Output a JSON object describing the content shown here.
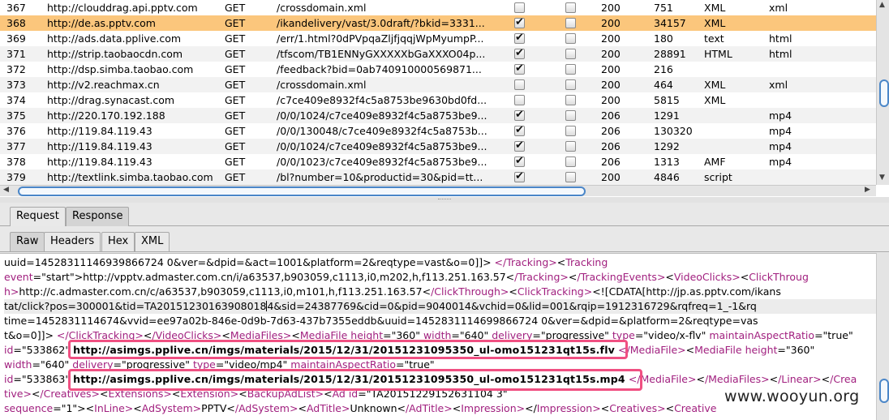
{
  "history": {
    "rows": [
      {
        "num": "367",
        "host": "http://clouddrag.api.pptv.com",
        "method": "GET",
        "url": "/crossdomain.xml",
        "chk1": false,
        "chk2": false,
        "status": "200",
        "length": "751",
        "mime": "XML",
        "ext": "xml",
        "state": "plain"
      },
      {
        "num": "368",
        "host": "http://de.as.pptv.com",
        "method": "GET",
        "url": "/ikandelivery/vast/3.0draft/?bkid=3331...",
        "chk1": true,
        "chk2": false,
        "status": "200",
        "length": "34157",
        "mime": "XML",
        "ext": "",
        "state": "selected"
      },
      {
        "num": "369",
        "host": "http://ads.data.pplive.com",
        "method": "GET",
        "url": "/err/1.html?0dPVpqaZljfjqqjWpMyumpP...",
        "chk1": true,
        "chk2": false,
        "status": "200",
        "length": "180",
        "mime": "text",
        "ext": "html",
        "state": "plain"
      },
      {
        "num": "371",
        "host": "http://strip.taobaocdn.com",
        "method": "GET",
        "url": "/tfscom/TB1ENNyGXXXXXbGaXXXO04p...",
        "chk1": true,
        "chk2": false,
        "status": "200",
        "length": "28891",
        "mime": "HTML",
        "ext": "html",
        "state": "alt"
      },
      {
        "num": "372",
        "host": "http://dsp.simba.taobao.com",
        "method": "GET",
        "url": "/feedback?bid=0ab740910000569871...",
        "chk1": true,
        "chk2": false,
        "status": "200",
        "length": "216",
        "mime": "",
        "ext": "",
        "state": "plain"
      },
      {
        "num": "373",
        "host": "http://v2.reachmax.cn",
        "method": "GET",
        "url": "/crossdomain.xml",
        "chk1": false,
        "chk2": false,
        "status": "200",
        "length": "464",
        "mime": "XML",
        "ext": "xml",
        "state": "alt"
      },
      {
        "num": "374",
        "host": "http://drag.synacast.com",
        "method": "GET",
        "url": "/c7ce409e8932f4c5a8753be9630bd0fd...",
        "chk1": false,
        "chk2": false,
        "status": "200",
        "length": "5815",
        "mime": "XML",
        "ext": "",
        "state": "plain"
      },
      {
        "num": "375",
        "host": "http://220.170.192.188",
        "method": "GET",
        "url": "/0/0/1024/c7ce409e8932f4c5a8753be9...",
        "chk1": true,
        "chk2": false,
        "status": "206",
        "length": "1291",
        "mime": "",
        "ext": "mp4",
        "state": "alt"
      },
      {
        "num": "376",
        "host": "http://119.84.119.43",
        "method": "GET",
        "url": "/0/0/130048/c7ce409e8932f4c5a8753b...",
        "chk1": true,
        "chk2": false,
        "status": "206",
        "length": "130320",
        "mime": "",
        "ext": "mp4",
        "state": "plain"
      },
      {
        "num": "377",
        "host": "http://119.84.119.43",
        "method": "GET",
        "url": "/0/0/1024/c7ce409e8932f4c5a8753be9...",
        "chk1": true,
        "chk2": false,
        "status": "206",
        "length": "1292",
        "mime": "",
        "ext": "mp4",
        "state": "alt"
      },
      {
        "num": "378",
        "host": "http://119.84.119.43",
        "method": "GET",
        "url": "/0/0/1023/c7ce409e8932f4c5a8753be9...",
        "chk1": true,
        "chk2": false,
        "status": "206",
        "length": "1313",
        "mime": "AMF",
        "ext": "mp4",
        "state": "plain"
      },
      {
        "num": "379",
        "host": "http://textlink.simba.taobao.com",
        "method": "GET",
        "url": "/bl?number=10&productid=30&pid=tt...",
        "chk1": true,
        "chk2": false,
        "status": "200",
        "length": "4846",
        "mime": "script",
        "ext": "",
        "state": "alt"
      }
    ]
  },
  "tabs_top": {
    "request": "Request",
    "response": "Response",
    "active": "Response"
  },
  "tabs_sub": {
    "raw": "Raw",
    "headers": "Headers",
    "hex": "Hex",
    "xml": "XML",
    "active": "Raw"
  },
  "response": {
    "lines": [
      [
        [
          "t",
          "uuid=14528311146939866724 0&ver=&dpid=&act=1001&platform=2&reqtype=vast&o=0]]"
        ],
        [
          "t",
          "> "
        ],
        [
          "m",
          "</Tracking>"
        ],
        [
          "t",
          "<"
        ],
        [
          "m",
          "Tracking"
        ]
      ],
      [
        [
          "m",
          "event"
        ],
        [
          "t",
          "=\"start\">http://vpptv.admaster.com.cn/i/a63537,b903059,c1113,i0,m202,h,f113.251.163.57<"
        ],
        [
          "m",
          "/Tracking>"
        ],
        [
          "t",
          "<"
        ],
        [
          "m",
          "/TrackingEvents>"
        ],
        [
          "t",
          "<"
        ],
        [
          "m",
          "VideoClicks>"
        ],
        [
          "t",
          "<"
        ],
        [
          "m",
          "ClickThroug"
        ]
      ],
      [
        [
          "m",
          "h>"
        ],
        [
          "t",
          "http://c.admaster.com.cn/c/a63537,b903059,c1113,i0,m101,h,f113.251.163.57<"
        ],
        [
          "m",
          "/ClickThrough>"
        ],
        [
          "t",
          "<"
        ],
        [
          "m",
          "ClickTracking>"
        ],
        [
          "t",
          "<![CDATA[http://jp.as.pptv.com/ikans"
        ]
      ],
      [
        [
          "t",
          "tat/click?pos=300001&tid=TA20151230163908018"
        ],
        [
          "cursor",
          ""
        ],
        [
          "t",
          "4&sid=24387769&cid=0&pid=9040014&vchid=0&lid=001&rqip=1912316729&rqfreq=1_-1&rq"
        ]
      ],
      [
        [
          "t",
          "time=1452831114674&vvid=ee97a02b-846e-0d9b-7d63-437b7355eddb&uuid=1452831114699866724 0&ver=&dpid=&platform=2&reqtype=vas"
        ]
      ],
      [
        [
          "t",
          "t&o=0]]>"
        ],
        [
          "m",
          " </ClickTracking>"
        ],
        [
          "t",
          "<"
        ],
        [
          "m",
          "/VideoClicks>"
        ],
        [
          "t",
          "<"
        ],
        [
          "m",
          "MediaFiles>"
        ],
        [
          "t",
          "<"
        ],
        [
          "m",
          "MediaFile height"
        ],
        [
          "t",
          "=\"360\" "
        ],
        [
          "m",
          "width"
        ],
        [
          "t",
          "=\"640\" "
        ],
        [
          "m",
          "delivery"
        ],
        [
          "t",
          "=\"progressive\" "
        ],
        [
          "m",
          "type"
        ],
        [
          "t",
          "=\"video/x-flv\" "
        ],
        [
          "m",
          "maintainAspectRatio"
        ],
        [
          "t",
          "=\"true\""
        ]
      ],
      [
        [
          "m",
          "id"
        ],
        [
          "t",
          "=\"533862\" "
        ],
        [
          "b",
          "http://asimgs.pplive.cn/imgs/materials/2015/12/31/20151231095350_ul-omo151231qt15s.flv"
        ],
        [
          "t",
          " "
        ],
        [
          "m",
          "</MediaFile>"
        ],
        [
          "t",
          "<"
        ],
        [
          "m",
          "MediaFile height"
        ],
        [
          "t",
          "=\"360\""
        ]
      ],
      [
        [
          "m",
          "width"
        ],
        [
          "t",
          "=\"640\" "
        ],
        [
          "m",
          "delivery"
        ],
        [
          "t",
          "=\"progressive\" "
        ],
        [
          "m",
          "type"
        ],
        [
          "t",
          "=\"video/mp4\" "
        ],
        [
          "m",
          "maintainAspectRatio"
        ],
        [
          "t",
          "=\"true\""
        ]
      ],
      [
        [
          "m",
          "id"
        ],
        [
          "t",
          "=\"533863\" "
        ],
        [
          "b",
          "http://asimgs.pplive.cn/imgs/materials/2015/12/31/20151231095350_ul-omo151231qt15s.mp4"
        ],
        [
          "t",
          " "
        ],
        [
          "m",
          "</MediaFile>"
        ],
        [
          "t",
          "<"
        ],
        [
          "m",
          "/MediaFiles>"
        ],
        [
          "t",
          "<"
        ],
        [
          "m",
          "/Linear>"
        ],
        [
          "t",
          "<"
        ],
        [
          "m",
          "/Crea"
        ]
      ],
      [
        [
          "m",
          "tive>"
        ],
        [
          "t",
          "<"
        ],
        [
          "m",
          "/Creatives>"
        ],
        [
          "t",
          "<"
        ],
        [
          "m",
          "Extensions>"
        ],
        [
          "t",
          "<"
        ],
        [
          "m",
          "Extension>"
        ],
        [
          "t",
          "<"
        ],
        [
          "m",
          "BackupAdList>"
        ],
        [
          "t",
          "<"
        ],
        [
          "m",
          "Ad id"
        ],
        [
          "t",
          "=\"TA20151229152631104 3\""
        ]
      ],
      [
        [
          "m",
          "sequence"
        ],
        [
          "t",
          "=\"1\">"
        ],
        [
          "t",
          "<"
        ],
        [
          "m",
          "InLine>"
        ],
        [
          "t",
          "<"
        ],
        [
          "m",
          "AdSystem>"
        ],
        [
          "t",
          "PPTV<"
        ],
        [
          "m",
          "/AdSystem>"
        ],
        [
          "t",
          "<"
        ],
        [
          "m",
          "AdTitle>"
        ],
        [
          "t",
          "Unknown<"
        ],
        [
          "m",
          "/AdTitle>"
        ],
        [
          "t",
          "<"
        ],
        [
          "m",
          "Impression>"
        ],
        [
          "t",
          "</"
        ],
        [
          "m",
          "Impression>"
        ],
        [
          "t",
          "<"
        ],
        [
          "m",
          "Creatives>"
        ],
        [
          "t",
          "<"
        ],
        [
          "m",
          "Creative"
        ]
      ]
    ]
  },
  "watermark": "www.wooyun.org",
  "colors": {
    "selected_row": "#fbc67c",
    "markup": "#a1207f",
    "highlight_box": "#f05082",
    "scroll_accent": "#4a86c8"
  }
}
